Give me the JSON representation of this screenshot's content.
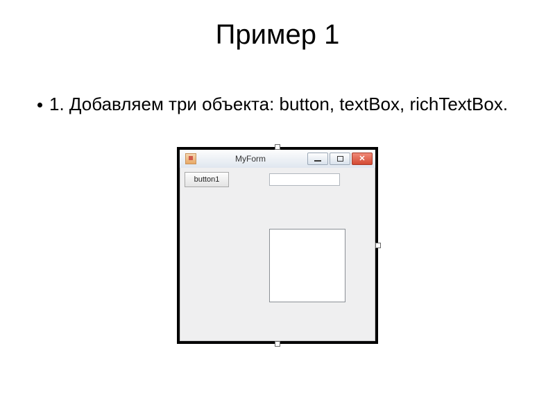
{
  "title": "Пример 1",
  "bullet": "1. Добавляем три объекта: button, textBox, richTextBox.",
  "window": {
    "title": "MyForm"
  },
  "controls": {
    "button1_label": "button1"
  }
}
